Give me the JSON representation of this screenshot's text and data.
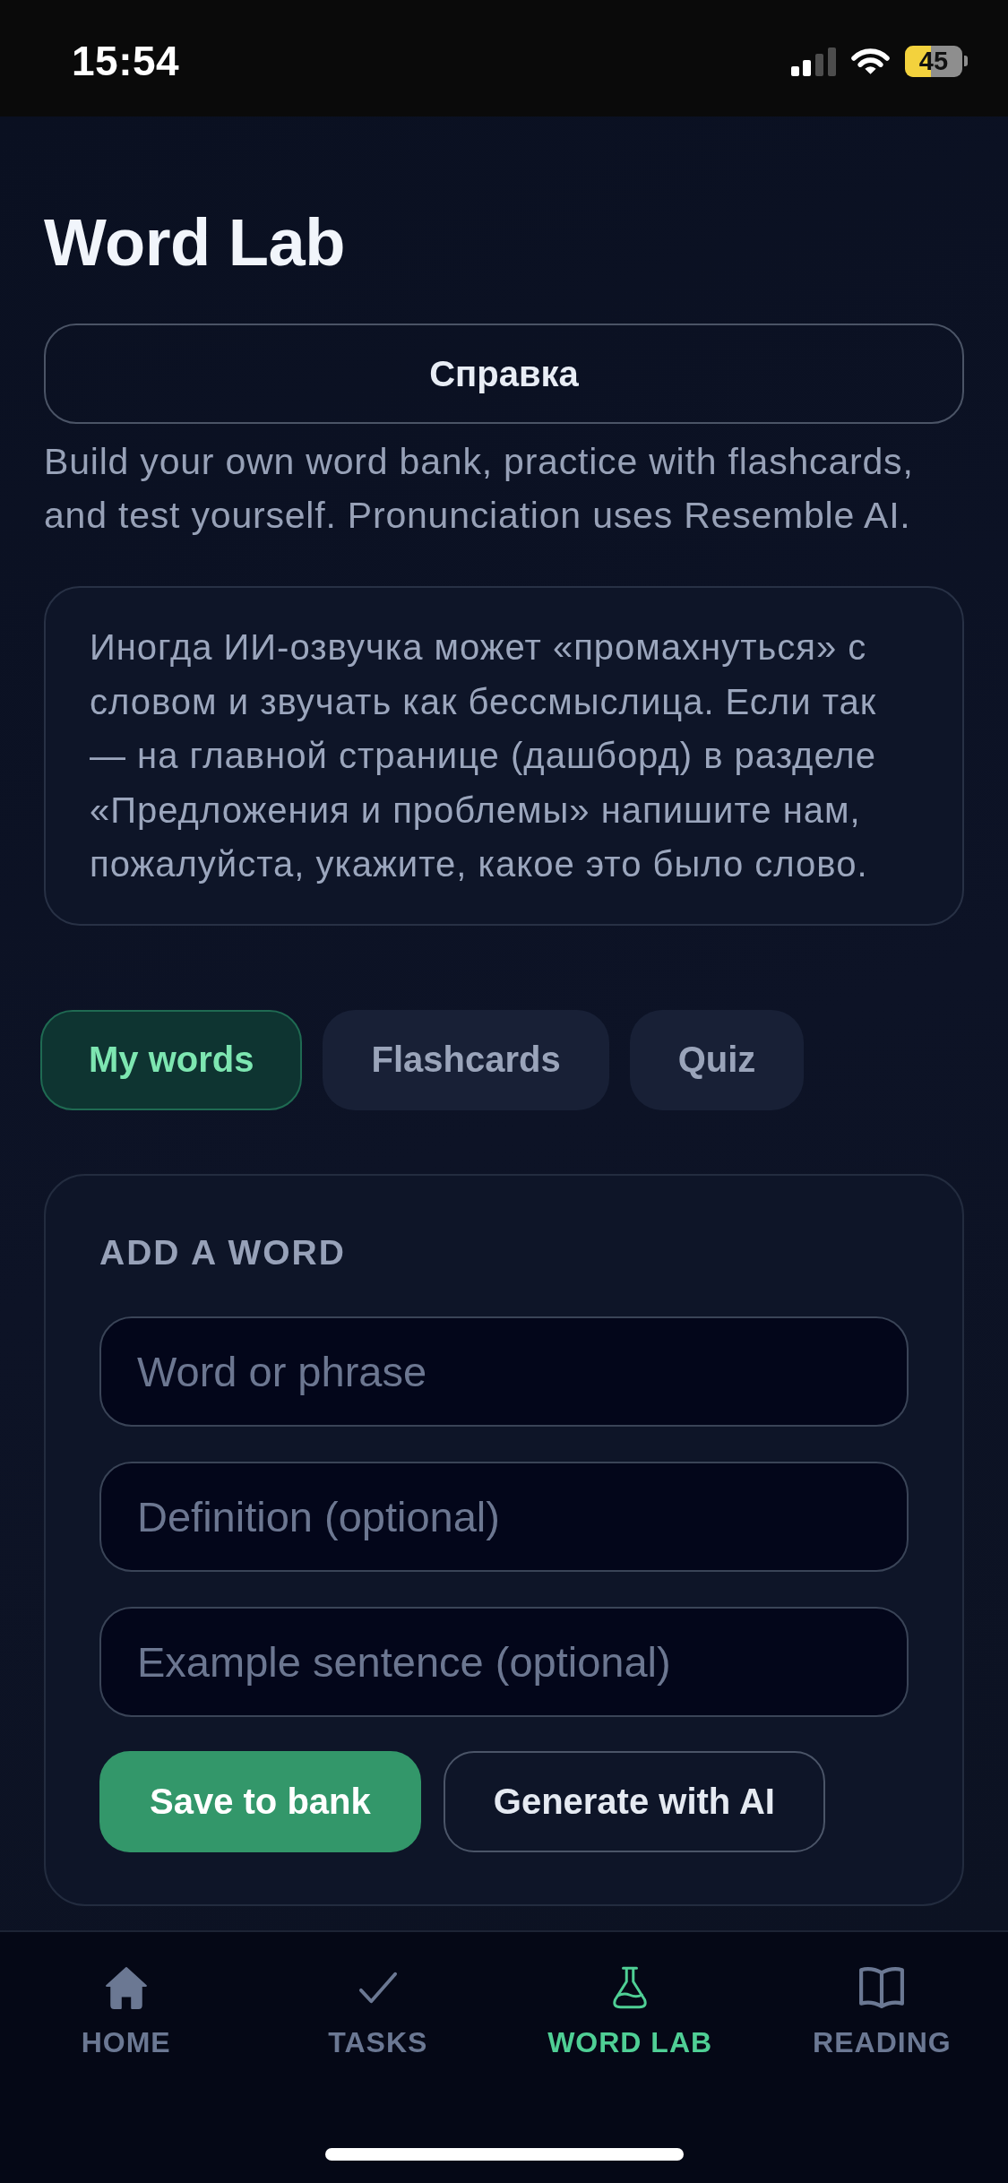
{
  "status_bar": {
    "time": "15:54",
    "battery": "45"
  },
  "header": {
    "title": "Word Lab",
    "help_button": "Справка",
    "description": "Build your own word bank, practice with flashcards, and test yourself. Pronunciation uses Resemble AI."
  },
  "notice": "Иногда ИИ-озвучка может «промахнуться» с словом и звучать как бессмыслица. Если так — на главной странице (дашборд) в разделе «Предложения и проблемы» напишите нам, пожалуйста, укажите, какое это было слово.",
  "tabs": [
    {
      "label": "My words",
      "selected": true
    },
    {
      "label": "Flashcards",
      "selected": false
    },
    {
      "label": "Quiz",
      "selected": false
    }
  ],
  "add_word_card": {
    "heading": "ADD A WORD",
    "fields": [
      {
        "placeholder": "Word or phrase"
      },
      {
        "placeholder": "Definition (optional)"
      },
      {
        "placeholder": "Example sentence (optional)"
      }
    ],
    "buttons": [
      {
        "label": "Save to bank",
        "kind": "primary"
      },
      {
        "label": "Generate with AI",
        "kind": "secondary"
      }
    ]
  },
  "bottom_nav": [
    {
      "label": "HOME",
      "kind": "home",
      "selected": false
    },
    {
      "label": "TASKS",
      "kind": "tasks",
      "selected": false
    },
    {
      "label": "WORD LAB",
      "kind": "lab",
      "selected": true
    },
    {
      "label": "READING",
      "kind": "reading",
      "selected": false
    }
  ]
}
